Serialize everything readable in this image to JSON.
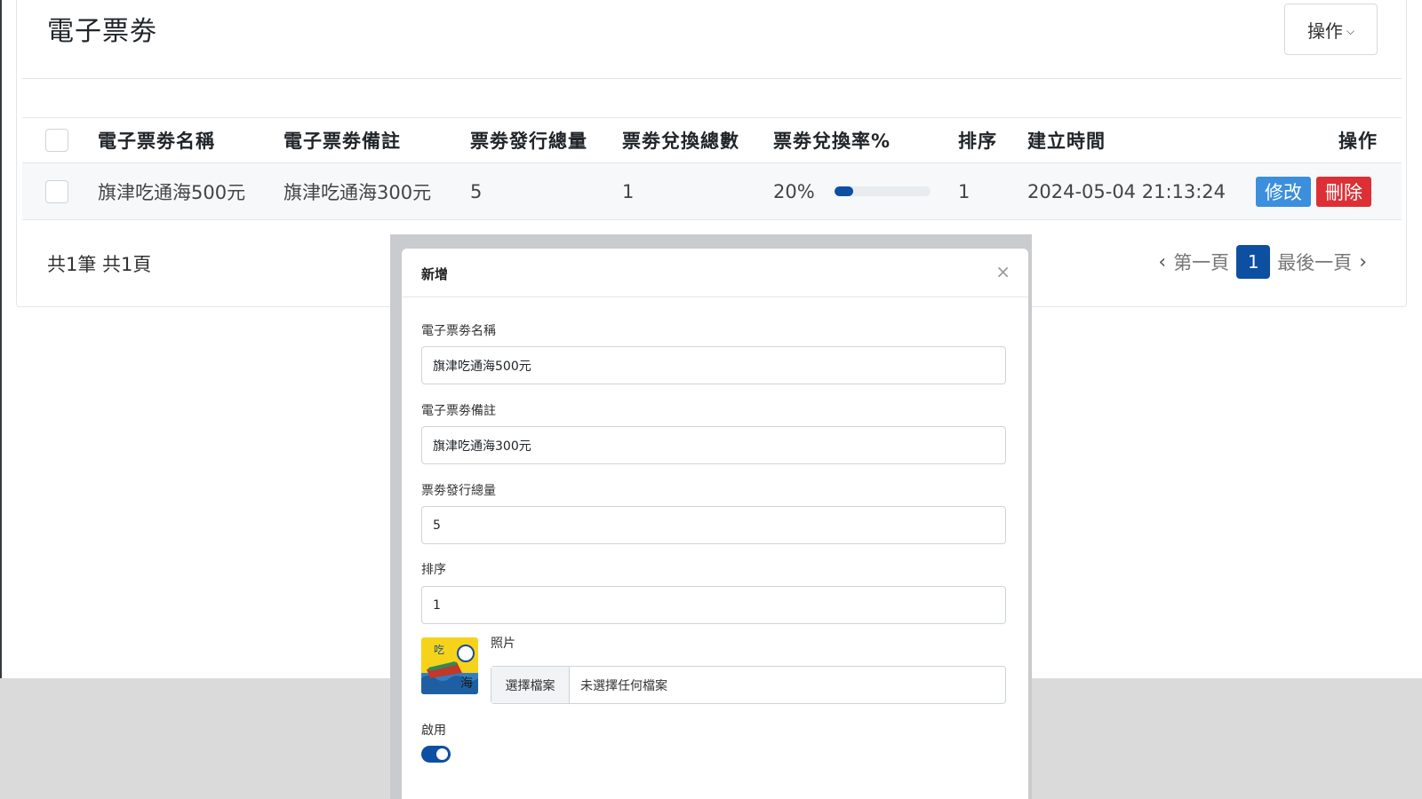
{
  "page": {
    "title": "電子票劵",
    "ops_label": "操作",
    "summary": "共1筆 共1頁"
  },
  "table": {
    "headers": [
      "電子票劵名稱",
      "電子票劵備註",
      "票劵發行總量",
      "票劵兌換總數",
      "票劵兌換率%",
      "排序",
      "建立時間",
      "操作"
    ],
    "rows": [
      {
        "name": "旗津吃通海500元",
        "note": "旗津吃通海300元",
        "issued": "5",
        "redeemed": "1",
        "rate_text": "20%",
        "rate": 20,
        "sort": "1",
        "created": "2024-05-04 21:13:24",
        "edit_label": "修改",
        "delete_label": "刪除"
      }
    ]
  },
  "pager": {
    "first": "第一頁",
    "current": "1",
    "last": "最後一頁"
  },
  "modal": {
    "title": "新增",
    "fields": {
      "name_label": "電子票劵名稱",
      "name_value": "旗津吃通海500元",
      "note_label": "電子票劵備註",
      "note_value": "旗津吃通海300元",
      "issued_label": "票劵發行總量",
      "issued_value": "5",
      "sort_label": "排序",
      "sort_value": "1",
      "photo_label": "照片",
      "file_button": "選擇檔案",
      "file_status": "未選擇任何檔案",
      "enabled_label": "啟用"
    },
    "enabled": true
  },
  "colors": {
    "primary": "#0d4fa1",
    "edit": "#3b8fdc",
    "delete": "#dc3036"
  },
  "icons": {
    "dropdown": "chevron-down-icon",
    "close": "close-icon",
    "prev": "chevron-left-icon",
    "next": "chevron-right-icon"
  }
}
